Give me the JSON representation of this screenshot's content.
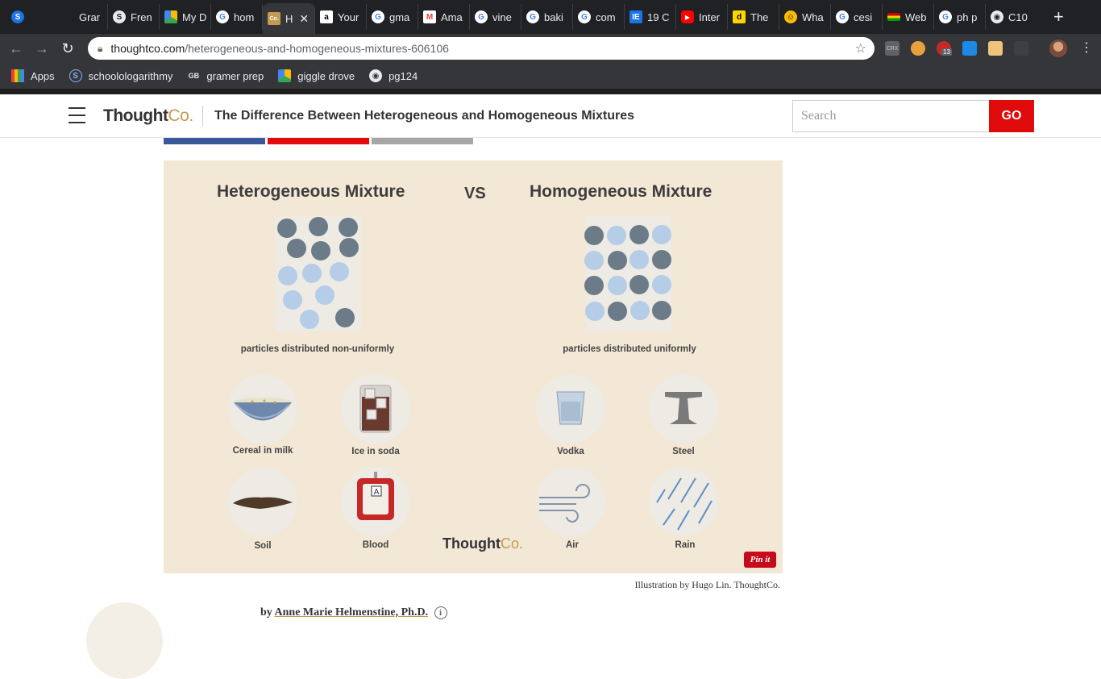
{
  "browser": {
    "tabs": [
      {
        "label": "",
        "favicon": "schoology-icon"
      },
      {
        "label": "Grar",
        "favicon": "blank"
      },
      {
        "label": "Fren",
        "favicon": "schoology-icon"
      },
      {
        "label": "My D",
        "favicon": "google-drive-icon"
      },
      {
        "label": "hom",
        "favicon": "google-icon"
      },
      {
        "label": "H",
        "favicon": "thoughtco-icon",
        "active": true
      },
      {
        "label": "Your",
        "favicon": "amazon-icon"
      },
      {
        "label": "gma",
        "favicon": "google-icon"
      },
      {
        "label": "Ama",
        "favicon": "gmail-icon"
      },
      {
        "label": "vine",
        "favicon": "google-icon"
      },
      {
        "label": "baki",
        "favicon": "google-icon"
      },
      {
        "label": "com",
        "favicon": "google-icon"
      },
      {
        "label": "19 C",
        "favicon": "ie-icon"
      },
      {
        "label": "Inter",
        "favicon": "youtube-icon"
      },
      {
        "label": "The",
        "favicon": "dictionary-icon"
      },
      {
        "label": "Wha",
        "favicon": "emoji-icon"
      },
      {
        "label": "cesi",
        "favicon": "google-icon"
      },
      {
        "label": "Web",
        "favicon": "flag-icon"
      },
      {
        "label": "ph p",
        "favicon": "google-icon"
      },
      {
        "label": "C10",
        "favicon": "chrome-icon"
      }
    ],
    "tab_active_favicon_text": "Co.",
    "url_host": "thoughtco.com",
    "url_path": "/heterogeneous-and-homogeneous-mixtures-606106",
    "ext_badge": "13",
    "crx_label": "CRX",
    "bookmarks": [
      {
        "label": "Apps",
        "icon": "apps-grid-icon"
      },
      {
        "label": "schoolologarithmy",
        "icon": "schoology-icon"
      },
      {
        "label": "gramer prep",
        "icon": "gb-icon"
      },
      {
        "label": "giggle drove",
        "icon": "google-drive-icon"
      },
      {
        "label": "pg124",
        "icon": "chrome-icon"
      }
    ]
  },
  "site": {
    "logo_main": "Thought",
    "logo_co": "Co.",
    "title": "The Difference Between Heterogeneous and Homogeneous Mixtures",
    "search_placeholder": "Search",
    "go_label": "GO"
  },
  "figure": {
    "left_heading": "Heterogeneous Mixture",
    "vs": "VS",
    "right_heading": "Homogeneous Mixture",
    "left_caption": "particles distributed non-uniformly",
    "right_caption": "particles distributed uniformly",
    "examples": {
      "cereal": "Cereal in milk",
      "ice": "Ice in soda",
      "soil": "Soil",
      "blood": "Blood",
      "vodka": "Vodka",
      "steel": "Steel",
      "air": "Air",
      "rain": "Rain"
    },
    "blood_bag_letter": "A",
    "watermark_main": "Thought",
    "watermark_co": "Co.",
    "pinit": "Pin it"
  },
  "credit": "Illustration by Hugo Lin. ThoughtCo.",
  "byline": {
    "prefix": "by",
    "author": "Anne Marie Helmenstine, Ph.D."
  },
  "colors": {
    "brand_gold": "#c29b4f",
    "go_red": "#e10b0b",
    "figure_bg": "#f2e8d5",
    "dark_particle": "#6c7b88",
    "light_particle": "#b5cde6"
  }
}
